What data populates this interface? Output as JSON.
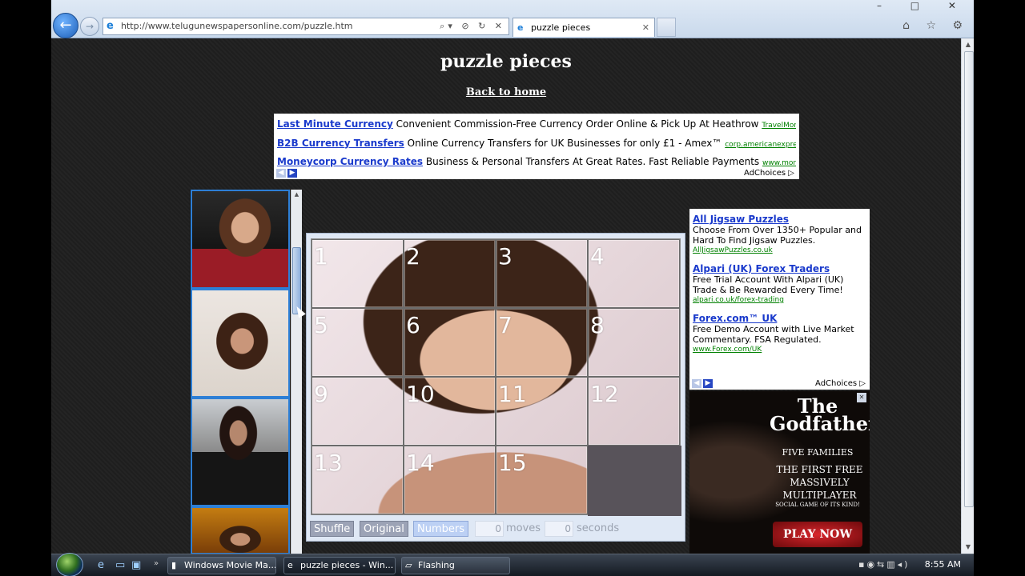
{
  "browser": {
    "url": "http://www.telugunewspapersonline.com/puzzle.htm",
    "tab_title": "puzzle pieces",
    "tab_close": "✕",
    "window_buttons": "–  □  ✕",
    "toolbar_icons": "⌂ ☆ ⚙",
    "addr_controls": "⌕▾ ⊘ ↻ ✕"
  },
  "page": {
    "title": "puzzle pieces",
    "back_link": "Back to home"
  },
  "top_ad": {
    "rows": [
      {
        "title": "Last Minute Currency",
        "desc": "Convenient Commission-Free Currency Order Online & Pick Up At Heathrow",
        "url": "TravelMoneyNow.com"
      },
      {
        "title": "B2B Currency Transfers",
        "desc": "Online Currency Transfers for UK Businesses for only £1 - Amex™",
        "url": "corp.americanexpress.com"
      },
      {
        "title": "Moneycorp Currency Rates",
        "desc": "Business & Personal Transfers At Great Rates. Fast Reliable Payments",
        "url": "www.moneycorp.com"
      }
    ],
    "adchoices": "AdChoices ▷"
  },
  "puzzle": {
    "tiles": [
      "1",
      "2",
      "3",
      "4",
      "5",
      "6",
      "7",
      "8",
      "9",
      "10",
      "11",
      "12",
      "13",
      "14",
      "15"
    ],
    "shuffle_label": "Shuffle",
    "original_label": "Original",
    "numbers_label": "Numbers",
    "moves_value": "0",
    "moves_label": "moves",
    "seconds_value": "0",
    "seconds_label": "seconds"
  },
  "right_ad": {
    "items": [
      {
        "title": "All Jigsaw Puzzles",
        "desc": "Choose From Over 1350+ Popular and Hard To Find Jigsaw Puzzles.",
        "url": "AllJigsawPuzzles.co.uk"
      },
      {
        "title": "Alpari (UK) Forex Traders",
        "desc": "Free Trial Account With Alpari (UK) Trade & Be Rewarded Every Time!",
        "url": "alpari.co.uk/forex-trading"
      },
      {
        "title": "Forex.com™ UK",
        "desc": "Free Demo Account with Live Market Commentary. FSA Regulated.",
        "url": "www.Forex.com/UK"
      }
    ],
    "adchoices": "AdChoices ▷"
  },
  "game_ad": {
    "logo": "The Godfather",
    "subtitle": "FIVE FAMILIES",
    "tagline": "THE FIRST FREE MASSIVELY MULTIPLAYER",
    "tagline2": "SOCIAL GAME OF ITS KIND!",
    "cta": "PLAY NOW"
  },
  "taskbar": {
    "tasks": [
      {
        "label": "Windows Movie Ma..."
      },
      {
        "label": "puzzle pieces - Win..."
      },
      {
        "label": "Flashing"
      }
    ],
    "clock": "8:55 AM"
  }
}
